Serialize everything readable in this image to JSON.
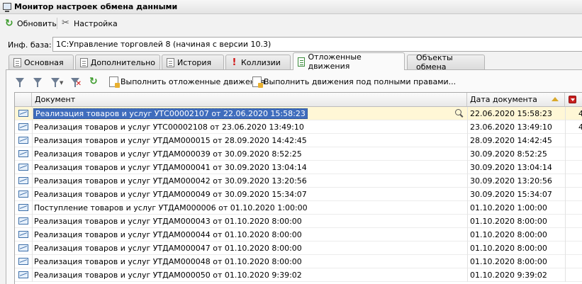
{
  "window": {
    "title": "Монитор настроек обмена данными"
  },
  "toolbar": {
    "refresh_label": "Обновить",
    "settings_label": "Настройка"
  },
  "infobase": {
    "label": "Инф. база:",
    "value": "1С:Управление торговлей 8 (начиная с версии 10.3)"
  },
  "tabs": [
    {
      "label": "Основная",
      "icon": "document-icon"
    },
    {
      "label": "Дополнительно",
      "icon": "document-icon"
    },
    {
      "label": "История",
      "icon": "document-icon"
    },
    {
      "label": "Коллизии",
      "icon": "warning-icon"
    },
    {
      "label": "Отложенные движения",
      "icon": "deferred-document-icon",
      "active": true
    },
    {
      "label": "Объекты обмена"
    }
  ],
  "panel_toolbar": {
    "run_deferred_label": "Выполнить отложенные движения",
    "run_full_rights_label": "Выполнить движения под полными правами..."
  },
  "grid": {
    "columns": {
      "document": "Документ",
      "date": "Дата документа"
    },
    "rows": [
      {
        "document": "Реализация товаров и услуг УТС00002107 от 22.06.2020 15:58:23",
        "date": "22.06.2020 15:58:23",
        "extra": "4"
      },
      {
        "document": "Реализация товаров и услуг УТС00002108 от 23.06.2020 13:49:10",
        "date": "23.06.2020 13:49:10",
        "extra": "4"
      },
      {
        "document": "Реализация товаров и услуг УТДАМ000015 от 28.09.2020 14:42:45",
        "date": "28.09.2020 14:42:45",
        "extra": ""
      },
      {
        "document": "Реализация товаров и услуг УТДАМ000039 от 30.09.2020 8:52:25",
        "date": "30.09.2020 8:52:25",
        "extra": ""
      },
      {
        "document": "Реализация товаров и услуг УТДАМ000041 от 30.09.2020 13:04:14",
        "date": "30.09.2020 13:04:14",
        "extra": ""
      },
      {
        "document": "Реализация товаров и услуг УТДАМ000042 от 30.09.2020 13:20:56",
        "date": "30.09.2020 13:20:56",
        "extra": ""
      },
      {
        "document": "Реализация товаров и услуг УТДАМ000049 от 30.09.2020 15:34:07",
        "date": "30.09.2020 15:34:07",
        "extra": ""
      },
      {
        "document": "Поступление товаров и услуг УТДАМ000006 от 01.10.2020 1:00:00",
        "date": "01.10.2020 1:00:00",
        "extra": ""
      },
      {
        "document": "Реализация товаров и услуг УТДАМ000043 от 01.10.2020 8:00:00",
        "date": "01.10.2020 8:00:00",
        "extra": ""
      },
      {
        "document": "Реализация товаров и услуг УТДАМ000044 от 01.10.2020 8:00:00",
        "date": "01.10.2020 8:00:00",
        "extra": ""
      },
      {
        "document": "Реализация товаров и услуг УТДАМ000047 от 01.10.2020 8:00:00",
        "date": "01.10.2020 8:00:00",
        "extra": ""
      },
      {
        "document": "Реализация товаров и услуг УТДАМ000048 от 01.10.2020 8:00:00",
        "date": "01.10.2020 8:00:00",
        "extra": ""
      },
      {
        "document": "Реализация товаров и услуг УТДАМ000050 от 01.10.2020 9:39:02",
        "date": "01.10.2020 9:39:02",
        "extra": ""
      }
    ]
  }
}
